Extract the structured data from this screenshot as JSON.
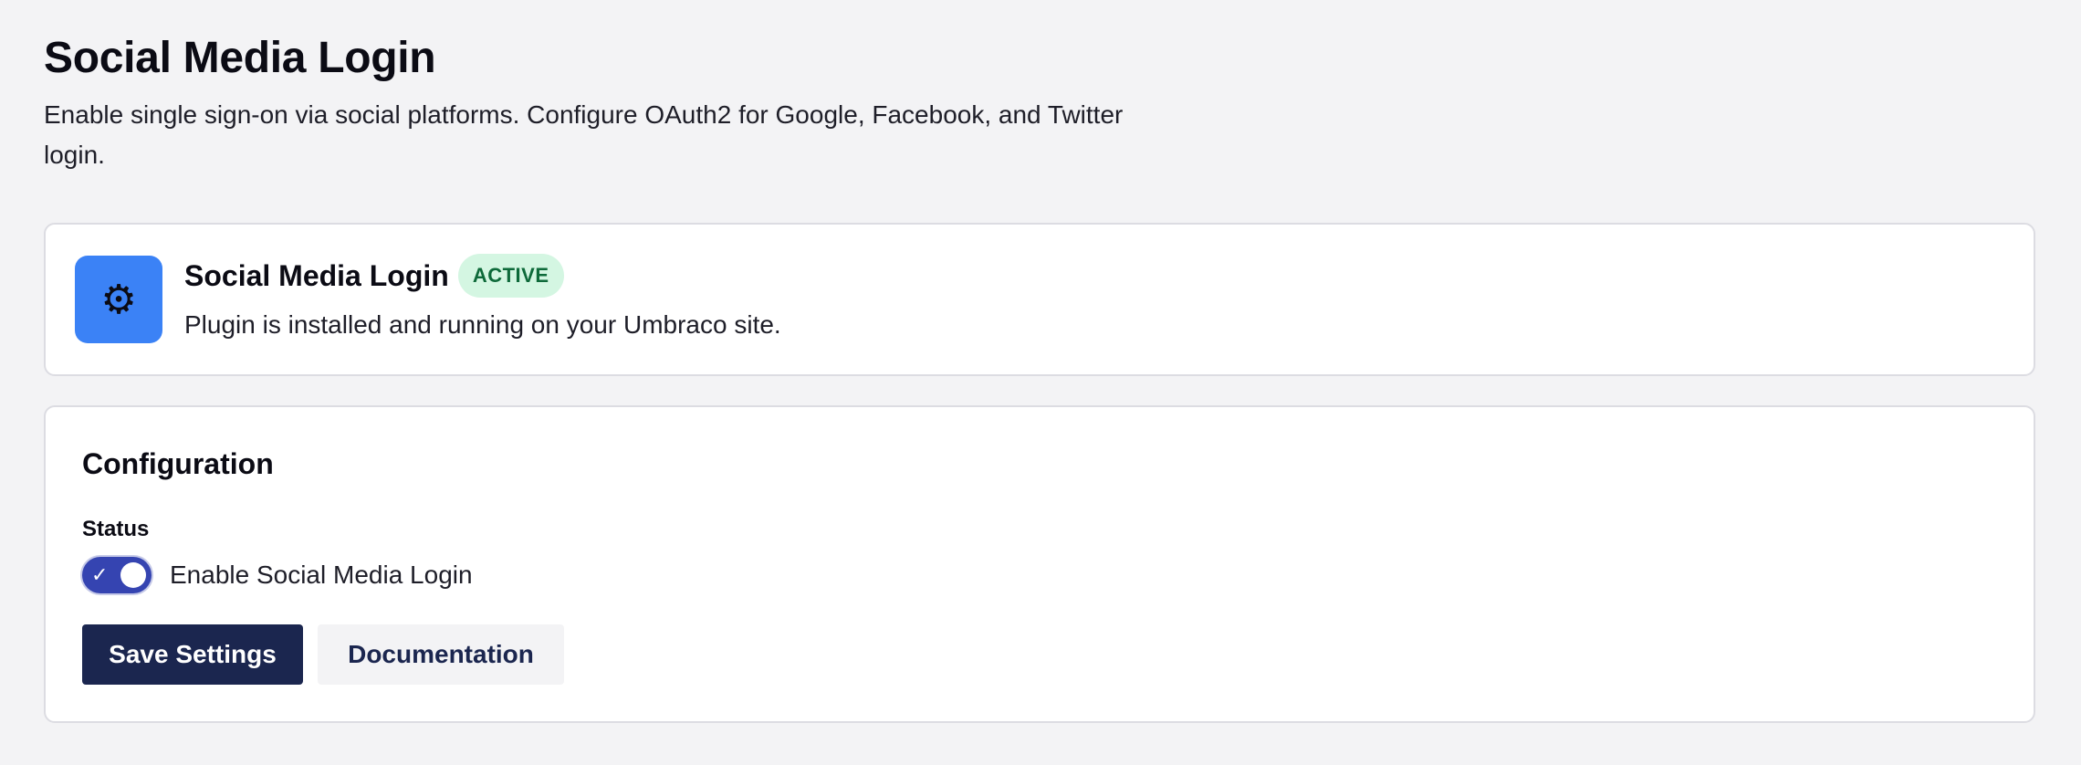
{
  "header": {
    "title": "Social Media Login",
    "description": "Enable single sign-on via social platforms. Configure OAuth2 for Google, Facebook, and Twitter login."
  },
  "plugin": {
    "icon": "gear-icon",
    "icon_glyph": "⚙",
    "icon_bg": "#3b82f6",
    "name": "Social Media Login",
    "badge": "ACTIVE",
    "badge_bg": "#d4f6e2",
    "badge_color": "#0e6a3a",
    "description": "Plugin is installed and running on your Umbraco site."
  },
  "configuration": {
    "title": "Configuration",
    "status_label": "Status",
    "toggle": {
      "checked": true,
      "check_glyph": "✓",
      "label": "Enable Social Media Login",
      "color": "#3544b1"
    },
    "buttons": {
      "save": "Save Settings",
      "documentation": "Documentation"
    },
    "primary_color": "#1b264f"
  }
}
